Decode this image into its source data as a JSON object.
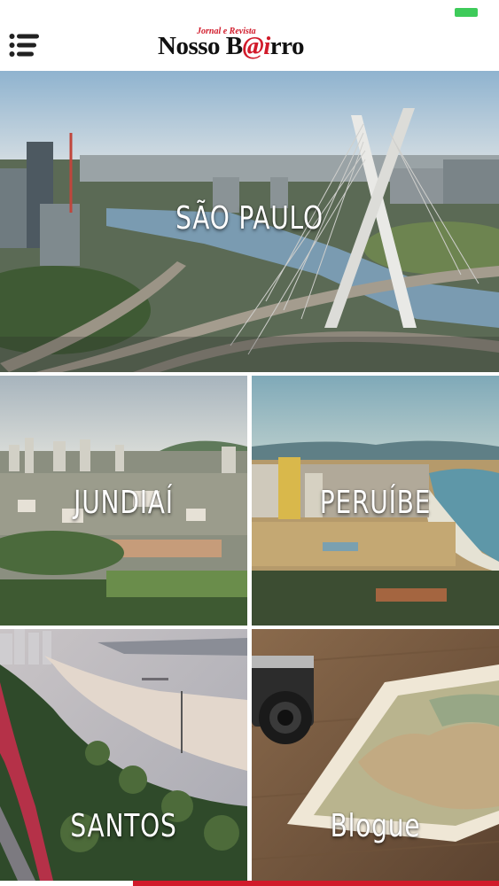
{
  "header": {
    "logo_tagline": "Jornal e Revista",
    "logo_word1": "Nosso ",
    "logo_word2_start": "B",
    "logo_word2_accent": "@i",
    "logo_word2_end": "rro",
    "menu_icon": "hamburger-menu-icon"
  },
  "colors": {
    "brand_red": "#d11a2a",
    "battery_green": "#3ecb5a"
  },
  "tiles": [
    {
      "label": "SÃO PAULO"
    },
    {
      "label": "JUNDIAÍ"
    },
    {
      "label": "PERUÍBE"
    },
    {
      "label": "SANTOS"
    },
    {
      "label": "Blogue"
    }
  ]
}
